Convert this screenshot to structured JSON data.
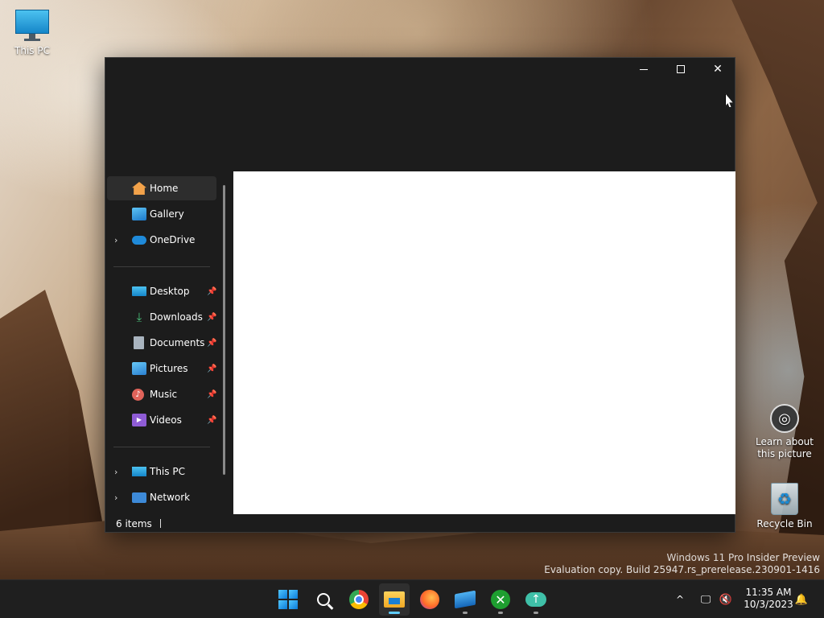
{
  "desktop": {
    "icons": [
      {
        "label": "This PC"
      },
      {
        "label": "Learn about this picture"
      },
      {
        "label": "Recycle Bin"
      }
    ],
    "watermark": {
      "line1": "Windows 11 Pro Insider Preview",
      "line2": "Evaluation copy. Build 25947.rs_prerelease.230901-1416"
    }
  },
  "window": {
    "controls": {
      "minimize": "—",
      "maximize": "☐",
      "close": "✕"
    },
    "nav": {
      "top": [
        {
          "label": "Home",
          "icon": "home-icon",
          "selected": true
        },
        {
          "label": "Gallery",
          "icon": "gallery-icon"
        },
        {
          "label": "OneDrive",
          "icon": "cloud-icon",
          "expandable": true
        }
      ],
      "quick_access": [
        {
          "label": "Desktop",
          "icon": "desktop-icon"
        },
        {
          "label": "Downloads",
          "icon": "download-icon"
        },
        {
          "label": "Documents",
          "icon": "documents-icon"
        },
        {
          "label": "Pictures",
          "icon": "pictures-icon"
        },
        {
          "label": "Music",
          "icon": "music-icon"
        },
        {
          "label": "Videos",
          "icon": "videos-icon"
        }
      ],
      "bottom": [
        {
          "label": "This PC",
          "icon": "computer-icon",
          "expandable": true
        },
        {
          "label": "Network",
          "icon": "network-icon",
          "expandable": true
        }
      ],
      "pin_glyph": "📌",
      "chevron_glyph": "›"
    },
    "status": {
      "items": "6 items"
    }
  },
  "taskbar": {
    "apps": [
      "start",
      "search",
      "chrome",
      "file-explorer",
      "firefox",
      "sandbox",
      "xbox",
      "upload"
    ],
    "active_app": "file-explorer",
    "tray": {
      "chevron": "^",
      "time": "11:35 AM",
      "date": "10/3/2023"
    }
  },
  "colors": {
    "window_bg": "#1c1c1c",
    "content_bg": "#ffffff",
    "taskbar_bg": "#1f1f1f",
    "accent": "#60cdff"
  }
}
